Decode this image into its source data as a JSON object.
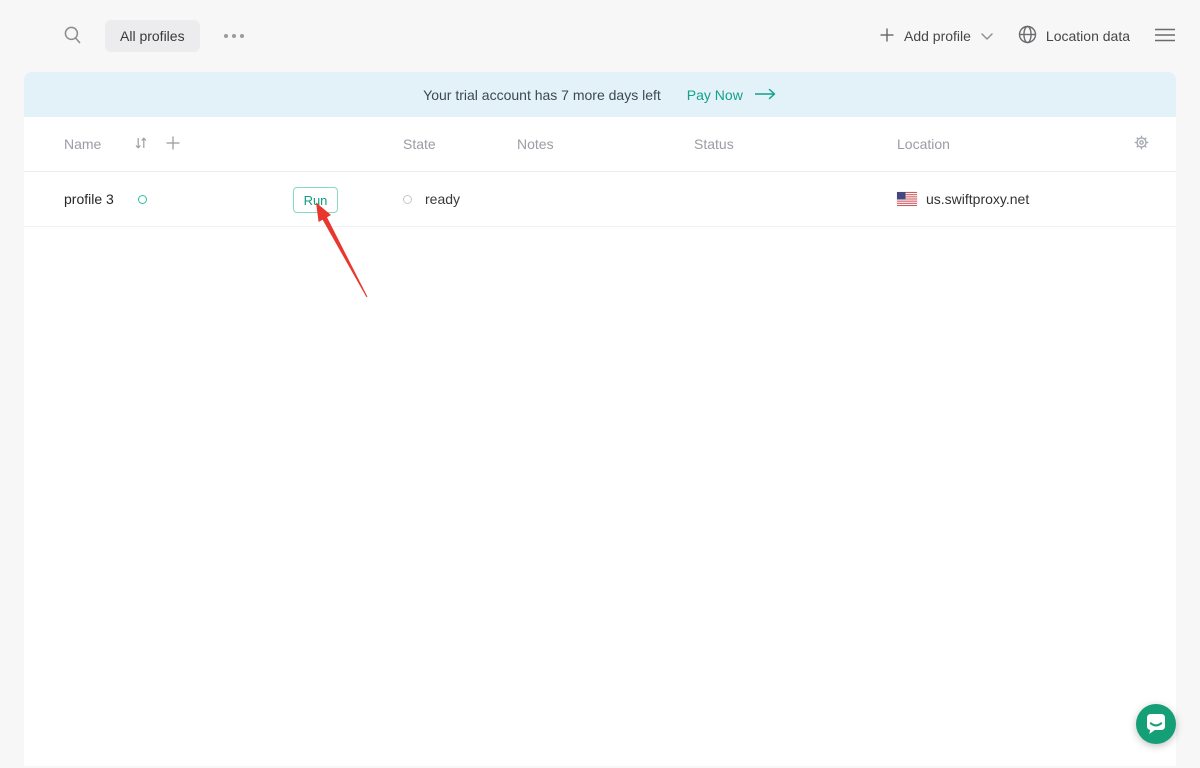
{
  "topbar": {
    "tab_all_profiles": "All profiles",
    "add_profile_label": "Add profile",
    "location_data_label": "Location data"
  },
  "banner": {
    "message": "Your trial account has 7 more days left",
    "cta_label": "Pay Now"
  },
  "table": {
    "headers": {
      "name": "Name",
      "state": "State",
      "notes": "Notes",
      "status": "Status",
      "location": "Location"
    },
    "rows": [
      {
        "name": "profile 3",
        "run_label": "Run",
        "state": "ready",
        "notes": "",
        "status": "",
        "location": "us.swiftproxy.net",
        "location_flag": "us-flag"
      }
    ]
  },
  "annotation": {
    "type": "arrow",
    "points_at": "run-button"
  },
  "colors": {
    "accent_teal": "#14a08b",
    "run_border_teal": "#8ad7c4",
    "banner_bg": "#e3f2f9",
    "chat_green": "#149f76",
    "arrow_red": "#e8372c",
    "page_bg": "#f7f7f8"
  }
}
